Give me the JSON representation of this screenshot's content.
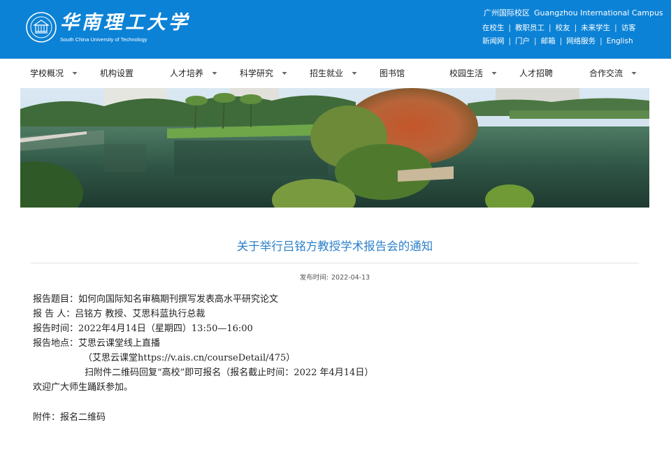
{
  "header": {
    "logo_cn": "华南理工大学",
    "logo_en": "South China University of Technology",
    "campus_cn": "广州国际校区",
    "campus_en": "Guangzhou International Campus",
    "links_row1": [
      "在校生",
      "教职员工",
      "校友",
      "未来学生",
      "访客"
    ],
    "links_row2": [
      "新闻网",
      "门户",
      "邮箱",
      "网络服务",
      "English"
    ],
    "bg_color": "#0c82d6"
  },
  "nav": {
    "items": [
      {
        "label": "学校概况",
        "has_dropdown": true
      },
      {
        "label": "机构设置",
        "has_dropdown": false
      },
      {
        "label": "人才培养",
        "has_dropdown": true
      },
      {
        "label": "科学研究",
        "has_dropdown": true
      },
      {
        "label": "招生就业",
        "has_dropdown": true
      },
      {
        "label": "图书馆",
        "has_dropdown": false
      },
      {
        "label": "校园生活",
        "has_dropdown": true
      },
      {
        "label": "人才招聘",
        "has_dropdown": false
      },
      {
        "label": "合作交流",
        "has_dropdown": true
      }
    ]
  },
  "article": {
    "title": "关于举行吕铭方教授学术报告会的通知",
    "pub_label": "发布时间:",
    "pub_date": "2022-04-13",
    "lines": [
      "报告题目：如何向国际知名审稿期刊撰写发表高水平研究论文",
      "报 告 人：吕铭方 教授、艾思科蓝执行总裁",
      "报告时间：2022年4月14日（星期四）13:50—16:00",
      "报告地点：艾思云课堂线上直播",
      "（艾思云课堂https://v.ais.cn/courseDetail/475）",
      "扫附件二维码回复“高校”即可报名（报名截止时间：2022 年4月14日）",
      "欢迎广大师生踊跃参加。",
      "附件：报名二维码"
    ]
  },
  "colors": {
    "title": "#2b7fc9",
    "header_bg": "#0c82d6"
  }
}
